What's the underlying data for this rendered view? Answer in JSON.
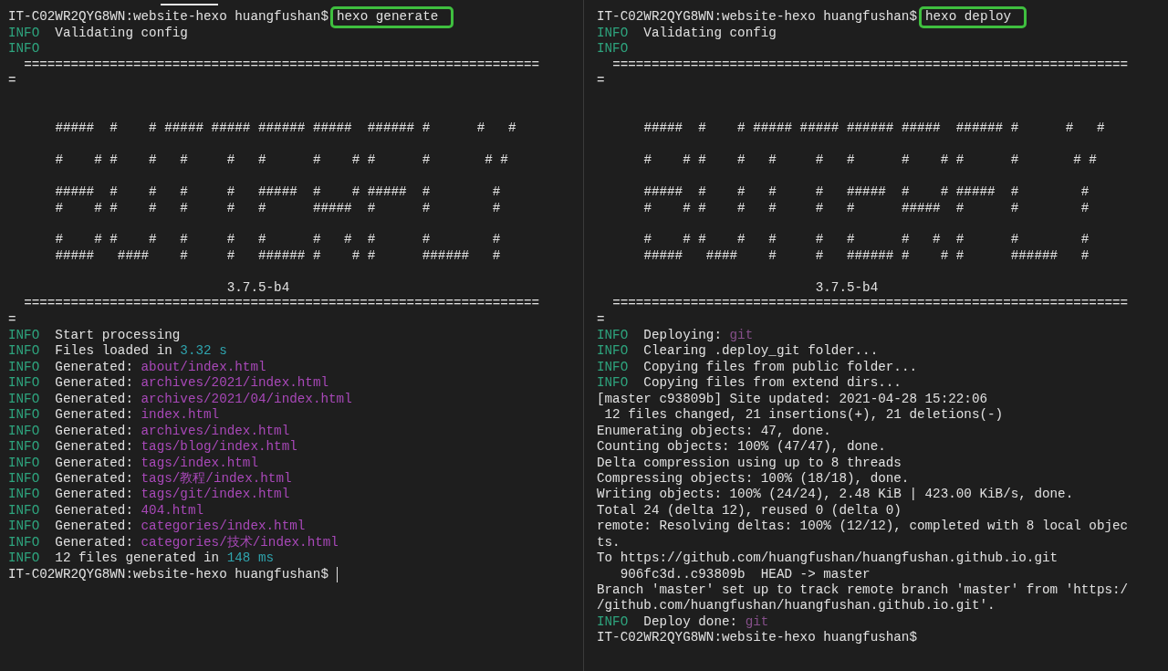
{
  "panes": [
    {
      "lines": [
        {
          "kind": "prompt",
          "prompt": "IT-C02WR2QYG8WN:website-hexo huangfushan$",
          "command": "hexo generate",
          "highlighted": true,
          "cursor": false
        },
        {
          "kind": "log",
          "segments": [
            {
              "kind": "level",
              "text": "INFO"
            },
            {
              "kind": "plain",
              "text": "  Validating config"
            }
          ]
        },
        {
          "kind": "log",
          "segments": [
            {
              "kind": "level",
              "text": "INFO"
            }
          ]
        },
        {
          "kind": "text",
          "text": "  =================================================================="
        },
        {
          "kind": "text",
          "text": "="
        },
        {
          "kind": "blank"
        },
        {
          "kind": "blank"
        },
        {
          "kind": "art",
          "text": "      #####  #    # ##### ##### ###### #####  ###### #      #   #"
        },
        {
          "kind": "blank"
        },
        {
          "kind": "art",
          "text": "      #    # #    #   #     #   #      #    # #      #       # #"
        },
        {
          "kind": "blank"
        },
        {
          "kind": "art",
          "text": "      #####  #    #   #     #   #####  #    # #####  #        #"
        },
        {
          "kind": "art",
          "text": "      #    # #    #   #     #   #      #####  #      #        #"
        },
        {
          "kind": "blank"
        },
        {
          "kind": "art",
          "text": "      #    # #    #   #     #   #      #   #  #      #        #"
        },
        {
          "kind": "art",
          "text": "      #####   ####    #     #   ###### #    # #      ######   #"
        },
        {
          "kind": "blank"
        },
        {
          "kind": "text",
          "text": "                            3.7.5-b4"
        },
        {
          "kind": "text",
          "text": "  =================================================================="
        },
        {
          "kind": "text",
          "text": "="
        },
        {
          "kind": "log",
          "segments": [
            {
              "kind": "level",
              "text": "INFO"
            },
            {
              "kind": "plain",
              "text": "  Start processing"
            }
          ]
        },
        {
          "kind": "log",
          "segments": [
            {
              "kind": "level",
              "text": "INFO"
            },
            {
              "kind": "plain",
              "text": "  Files loaded in "
            },
            {
              "kind": "number",
              "text": "3.32 s"
            }
          ]
        },
        {
          "kind": "log",
          "segments": [
            {
              "kind": "level",
              "text": "INFO"
            },
            {
              "kind": "plain",
              "text": "  Generated: "
            },
            {
              "kind": "path",
              "text": "about/index.html"
            }
          ]
        },
        {
          "kind": "log",
          "segments": [
            {
              "kind": "level",
              "text": "INFO"
            },
            {
              "kind": "plain",
              "text": "  Generated: "
            },
            {
              "kind": "path",
              "text": "archives/2021/index.html"
            }
          ]
        },
        {
          "kind": "log",
          "segments": [
            {
              "kind": "level",
              "text": "INFO"
            },
            {
              "kind": "plain",
              "text": "  Generated: "
            },
            {
              "kind": "path",
              "text": "archives/2021/04/index.html"
            }
          ]
        },
        {
          "kind": "log",
          "segments": [
            {
              "kind": "level",
              "text": "INFO"
            },
            {
              "kind": "plain",
              "text": "  Generated: "
            },
            {
              "kind": "path",
              "text": "index.html"
            }
          ]
        },
        {
          "kind": "log",
          "segments": [
            {
              "kind": "level",
              "text": "INFO"
            },
            {
              "kind": "plain",
              "text": "  Generated: "
            },
            {
              "kind": "path",
              "text": "archives/index.html"
            }
          ]
        },
        {
          "kind": "log",
          "segments": [
            {
              "kind": "level",
              "text": "INFO"
            },
            {
              "kind": "plain",
              "text": "  Generated: "
            },
            {
              "kind": "path",
              "text": "tags/blog/index.html"
            }
          ]
        },
        {
          "kind": "log",
          "segments": [
            {
              "kind": "level",
              "text": "INFO"
            },
            {
              "kind": "plain",
              "text": "  Generated: "
            },
            {
              "kind": "path",
              "text": "tags/index.html"
            }
          ]
        },
        {
          "kind": "log",
          "segments": [
            {
              "kind": "level",
              "text": "INFO"
            },
            {
              "kind": "plain",
              "text": "  Generated: "
            },
            {
              "kind": "path",
              "text": "tags/教程/index.html"
            }
          ]
        },
        {
          "kind": "log",
          "segments": [
            {
              "kind": "level",
              "text": "INFO"
            },
            {
              "kind": "plain",
              "text": "  Generated: "
            },
            {
              "kind": "path",
              "text": "tags/git/index.html"
            }
          ]
        },
        {
          "kind": "log",
          "segments": [
            {
              "kind": "level",
              "text": "INFO"
            },
            {
              "kind": "plain",
              "text": "  Generated: "
            },
            {
              "kind": "path",
              "text": "404.html"
            }
          ]
        },
        {
          "kind": "log",
          "segments": [
            {
              "kind": "level",
              "text": "INFO"
            },
            {
              "kind": "plain",
              "text": "  Generated: "
            },
            {
              "kind": "path",
              "text": "categories/index.html"
            }
          ]
        },
        {
          "kind": "log",
          "segments": [
            {
              "kind": "level",
              "text": "INFO"
            },
            {
              "kind": "plain",
              "text": "  Generated: "
            },
            {
              "kind": "path",
              "text": "categories/技术/index.html"
            }
          ]
        },
        {
          "kind": "log",
          "segments": [
            {
              "kind": "level",
              "text": "INFO"
            },
            {
              "kind": "plain",
              "text": "  12 files generated in "
            },
            {
              "kind": "number",
              "text": "148 ms"
            }
          ]
        },
        {
          "kind": "prompt",
          "prompt": "IT-C02WR2QYG8WN:website-hexo huangfushan$",
          "cursor": true
        }
      ]
    },
    {
      "lines": [
        {
          "kind": "prompt",
          "prompt": "IT-C02WR2QYG8WN:website-hexo huangfushan$",
          "command": "hexo deploy",
          "highlighted": true,
          "cursor": false
        },
        {
          "kind": "log",
          "segments": [
            {
              "kind": "level",
              "text": "INFO"
            },
            {
              "kind": "plain",
              "text": "  Validating config"
            }
          ]
        },
        {
          "kind": "log",
          "segments": [
            {
              "kind": "level",
              "text": "INFO"
            }
          ]
        },
        {
          "kind": "text",
          "text": "  =================================================================="
        },
        {
          "kind": "text",
          "text": "="
        },
        {
          "kind": "blank"
        },
        {
          "kind": "blank"
        },
        {
          "kind": "art",
          "text": "      #####  #    # ##### ##### ###### #####  ###### #      #   #"
        },
        {
          "kind": "blank"
        },
        {
          "kind": "art",
          "text": "      #    # #    #   #     #   #      #    # #      #       # #"
        },
        {
          "kind": "blank"
        },
        {
          "kind": "art",
          "text": "      #####  #    #   #     #   #####  #    # #####  #        #"
        },
        {
          "kind": "art",
          "text": "      #    # #    #   #     #   #      #####  #      #        #"
        },
        {
          "kind": "blank"
        },
        {
          "kind": "art",
          "text": "      #    # #    #   #     #   #      #   #  #      #        #"
        },
        {
          "kind": "art",
          "text": "      #####   ####    #     #   ###### #    # #      ######   #"
        },
        {
          "kind": "blank"
        },
        {
          "kind": "text",
          "text": "                            3.7.5-b4"
        },
        {
          "kind": "text",
          "text": "  =================================================================="
        },
        {
          "kind": "text",
          "text": "="
        },
        {
          "kind": "log",
          "segments": [
            {
              "kind": "level",
              "text": "INFO"
            },
            {
              "kind": "plain",
              "text": "  Deploying: "
            },
            {
              "kind": "name",
              "text": "git"
            }
          ]
        },
        {
          "kind": "log",
          "segments": [
            {
              "kind": "level",
              "text": "INFO"
            },
            {
              "kind": "plain",
              "text": "  Clearing .deploy_git folder..."
            }
          ]
        },
        {
          "kind": "log",
          "segments": [
            {
              "kind": "level",
              "text": "INFO"
            },
            {
              "kind": "plain",
              "text": "  Copying files from public folder..."
            }
          ]
        },
        {
          "kind": "log",
          "segments": [
            {
              "kind": "level",
              "text": "INFO"
            },
            {
              "kind": "plain",
              "text": "  Copying files from extend dirs..."
            }
          ]
        },
        {
          "kind": "text",
          "text": "[master c93809b] Site updated: 2021-04-28 15:22:06"
        },
        {
          "kind": "text",
          "text": " 12 files changed, 21 insertions(+), 21 deletions(-)"
        },
        {
          "kind": "text",
          "text": "Enumerating objects: 47, done."
        },
        {
          "kind": "text",
          "text": "Counting objects: 100% (47/47), done."
        },
        {
          "kind": "text",
          "text": "Delta compression using up to 8 threads"
        },
        {
          "kind": "text",
          "text": "Compressing objects: 100% (18/18), done."
        },
        {
          "kind": "text",
          "text": "Writing objects: 100% (24/24), 2.48 KiB | 423.00 KiB/s, done."
        },
        {
          "kind": "text",
          "text": "Total 24 (delta 12), reused 0 (delta 0)"
        },
        {
          "kind": "text",
          "text": "remote: Resolving deltas: 100% (12/12), completed with 8 local objec"
        },
        {
          "kind": "text",
          "text": "ts."
        },
        {
          "kind": "text",
          "text": "To https://github.com/huangfushan/huangfushan.github.io.git"
        },
        {
          "kind": "text",
          "text": "   906fc3d..c93809b  HEAD -> master"
        },
        {
          "kind": "text",
          "text": "Branch 'master' set up to track remote branch 'master' from 'https:/"
        },
        {
          "kind": "text",
          "text": "/github.com/huangfushan/huangfushan.github.io.git'."
        },
        {
          "kind": "log",
          "segments": [
            {
              "kind": "level",
              "text": "INFO"
            },
            {
              "kind": "plain",
              "text": "  Deploy done: "
            },
            {
              "kind": "name",
              "text": "git"
            }
          ]
        },
        {
          "kind": "prompt",
          "prompt": "IT-C02WR2QYG8WN:website-hexo huangfushan$",
          "cursor": false
        }
      ]
    }
  ]
}
